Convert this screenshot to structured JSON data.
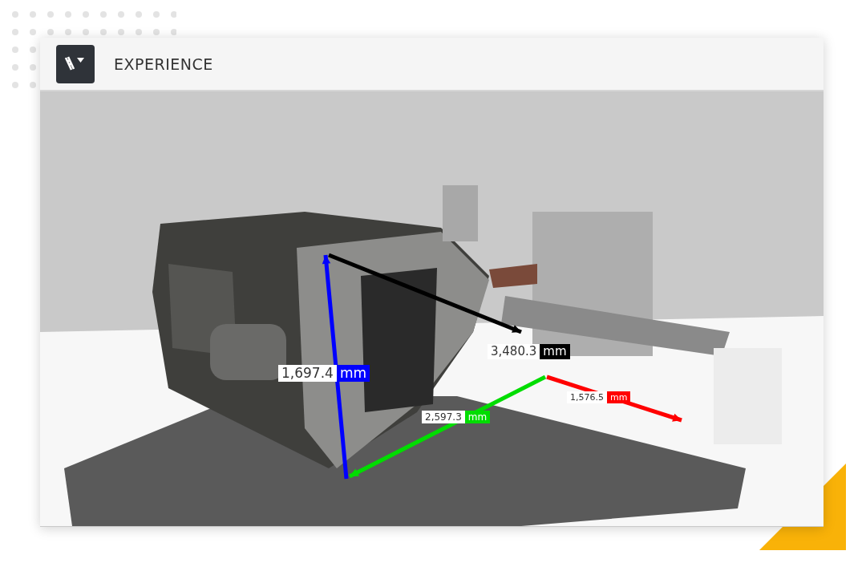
{
  "window": {
    "title": "EXPERIENCE"
  },
  "measurements": [
    {
      "value": "1,697.4",
      "unit": "mm",
      "color": "#0000ff"
    },
    {
      "value": "3,480.3",
      "unit": "mm",
      "color": "#000000"
    },
    {
      "value": "2,597.3",
      "unit": "mm",
      "color": "#00dd00"
    },
    {
      "value": "1,576.5",
      "unit": "mm",
      "color": "#ff0000"
    }
  ]
}
